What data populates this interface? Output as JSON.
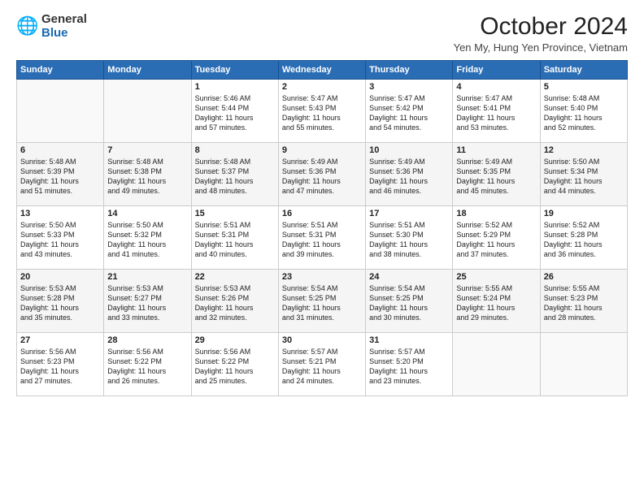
{
  "logo": {
    "general": "General",
    "blue": "Blue"
  },
  "title": "October 2024",
  "location": "Yen My, Hung Yen Province, Vietnam",
  "headers": [
    "Sunday",
    "Monday",
    "Tuesday",
    "Wednesday",
    "Thursday",
    "Friday",
    "Saturday"
  ],
  "weeks": [
    [
      {
        "day": "",
        "info": ""
      },
      {
        "day": "",
        "info": ""
      },
      {
        "day": "1",
        "info": "Sunrise: 5:46 AM\nSunset: 5:44 PM\nDaylight: 11 hours\nand 57 minutes."
      },
      {
        "day": "2",
        "info": "Sunrise: 5:47 AM\nSunset: 5:43 PM\nDaylight: 11 hours\nand 55 minutes."
      },
      {
        "day": "3",
        "info": "Sunrise: 5:47 AM\nSunset: 5:42 PM\nDaylight: 11 hours\nand 54 minutes."
      },
      {
        "day": "4",
        "info": "Sunrise: 5:47 AM\nSunset: 5:41 PM\nDaylight: 11 hours\nand 53 minutes."
      },
      {
        "day": "5",
        "info": "Sunrise: 5:48 AM\nSunset: 5:40 PM\nDaylight: 11 hours\nand 52 minutes."
      }
    ],
    [
      {
        "day": "6",
        "info": "Sunrise: 5:48 AM\nSunset: 5:39 PM\nDaylight: 11 hours\nand 51 minutes."
      },
      {
        "day": "7",
        "info": "Sunrise: 5:48 AM\nSunset: 5:38 PM\nDaylight: 11 hours\nand 49 minutes."
      },
      {
        "day": "8",
        "info": "Sunrise: 5:48 AM\nSunset: 5:37 PM\nDaylight: 11 hours\nand 48 minutes."
      },
      {
        "day": "9",
        "info": "Sunrise: 5:49 AM\nSunset: 5:36 PM\nDaylight: 11 hours\nand 47 minutes."
      },
      {
        "day": "10",
        "info": "Sunrise: 5:49 AM\nSunset: 5:36 PM\nDaylight: 11 hours\nand 46 minutes."
      },
      {
        "day": "11",
        "info": "Sunrise: 5:49 AM\nSunset: 5:35 PM\nDaylight: 11 hours\nand 45 minutes."
      },
      {
        "day": "12",
        "info": "Sunrise: 5:50 AM\nSunset: 5:34 PM\nDaylight: 11 hours\nand 44 minutes."
      }
    ],
    [
      {
        "day": "13",
        "info": "Sunrise: 5:50 AM\nSunset: 5:33 PM\nDaylight: 11 hours\nand 43 minutes."
      },
      {
        "day": "14",
        "info": "Sunrise: 5:50 AM\nSunset: 5:32 PM\nDaylight: 11 hours\nand 41 minutes."
      },
      {
        "day": "15",
        "info": "Sunrise: 5:51 AM\nSunset: 5:31 PM\nDaylight: 11 hours\nand 40 minutes."
      },
      {
        "day": "16",
        "info": "Sunrise: 5:51 AM\nSunset: 5:31 PM\nDaylight: 11 hours\nand 39 minutes."
      },
      {
        "day": "17",
        "info": "Sunrise: 5:51 AM\nSunset: 5:30 PM\nDaylight: 11 hours\nand 38 minutes."
      },
      {
        "day": "18",
        "info": "Sunrise: 5:52 AM\nSunset: 5:29 PM\nDaylight: 11 hours\nand 37 minutes."
      },
      {
        "day": "19",
        "info": "Sunrise: 5:52 AM\nSunset: 5:28 PM\nDaylight: 11 hours\nand 36 minutes."
      }
    ],
    [
      {
        "day": "20",
        "info": "Sunrise: 5:53 AM\nSunset: 5:28 PM\nDaylight: 11 hours\nand 35 minutes."
      },
      {
        "day": "21",
        "info": "Sunrise: 5:53 AM\nSunset: 5:27 PM\nDaylight: 11 hours\nand 33 minutes."
      },
      {
        "day": "22",
        "info": "Sunrise: 5:53 AM\nSunset: 5:26 PM\nDaylight: 11 hours\nand 32 minutes."
      },
      {
        "day": "23",
        "info": "Sunrise: 5:54 AM\nSunset: 5:25 PM\nDaylight: 11 hours\nand 31 minutes."
      },
      {
        "day": "24",
        "info": "Sunrise: 5:54 AM\nSunset: 5:25 PM\nDaylight: 11 hours\nand 30 minutes."
      },
      {
        "day": "25",
        "info": "Sunrise: 5:55 AM\nSunset: 5:24 PM\nDaylight: 11 hours\nand 29 minutes."
      },
      {
        "day": "26",
        "info": "Sunrise: 5:55 AM\nSunset: 5:23 PM\nDaylight: 11 hours\nand 28 minutes."
      }
    ],
    [
      {
        "day": "27",
        "info": "Sunrise: 5:56 AM\nSunset: 5:23 PM\nDaylight: 11 hours\nand 27 minutes."
      },
      {
        "day": "28",
        "info": "Sunrise: 5:56 AM\nSunset: 5:22 PM\nDaylight: 11 hours\nand 26 minutes."
      },
      {
        "day": "29",
        "info": "Sunrise: 5:56 AM\nSunset: 5:22 PM\nDaylight: 11 hours\nand 25 minutes."
      },
      {
        "day": "30",
        "info": "Sunrise: 5:57 AM\nSunset: 5:21 PM\nDaylight: 11 hours\nand 24 minutes."
      },
      {
        "day": "31",
        "info": "Sunrise: 5:57 AM\nSunset: 5:20 PM\nDaylight: 11 hours\nand 23 minutes."
      },
      {
        "day": "",
        "info": ""
      },
      {
        "day": "",
        "info": ""
      }
    ]
  ]
}
